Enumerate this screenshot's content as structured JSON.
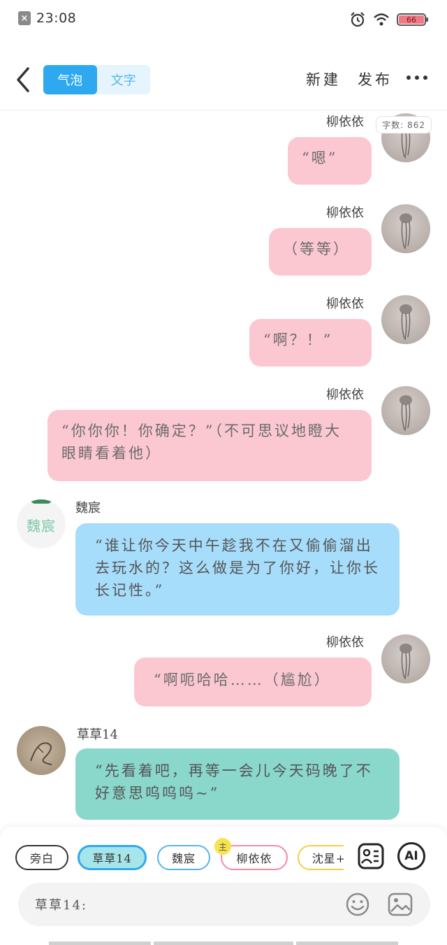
{
  "status_bar": {
    "time": "23:08",
    "battery": "66"
  },
  "header": {
    "tabs": [
      {
        "label": "气泡",
        "active": true
      },
      {
        "label": "文字",
        "active": false
      }
    ],
    "new_label": "新建",
    "publish_label": "发布"
  },
  "word_count": "字数: 862",
  "messages": [
    {
      "speaker": "柳依依",
      "text": "“嗯”"
    },
    {
      "speaker": "柳依依",
      "text": "（等等）"
    },
    {
      "speaker": "柳依依",
      "text": "“啊？！”"
    },
    {
      "speaker": "柳依依",
      "text": "“你你你！你确定？”（不可思议地瞪大眼睛看着他）"
    },
    {
      "speaker": "魏宸",
      "text": "“谁让你今天中午趁我不在又偷偷溜出去玩水的？这么做是为了你好，让你长长记性。”",
      "avatar_text": "魏宸"
    },
    {
      "speaker": "柳依依",
      "text": "“啊呃哈哈……（尴尬）"
    },
    {
      "speaker": "草草14",
      "text": "“先看着吧，再等一会儿今天码晚了不好意思呜呜呜~”"
    }
  ],
  "characters": [
    {
      "label": "旁白"
    },
    {
      "label": "草草14",
      "selected": true
    },
    {
      "label": "魏宸"
    },
    {
      "label": "柳依依",
      "badge": "主"
    },
    {
      "label": "沈星+"
    }
  ],
  "ai_label": "AI",
  "input": {
    "placeholder": "草草14:"
  },
  "colors": {
    "pink_bubble": "#fbc8d2",
    "blue_bubble": "#a6ddfb",
    "green_bubble": "#8ad7cc",
    "accent": "#2ea9ef"
  }
}
